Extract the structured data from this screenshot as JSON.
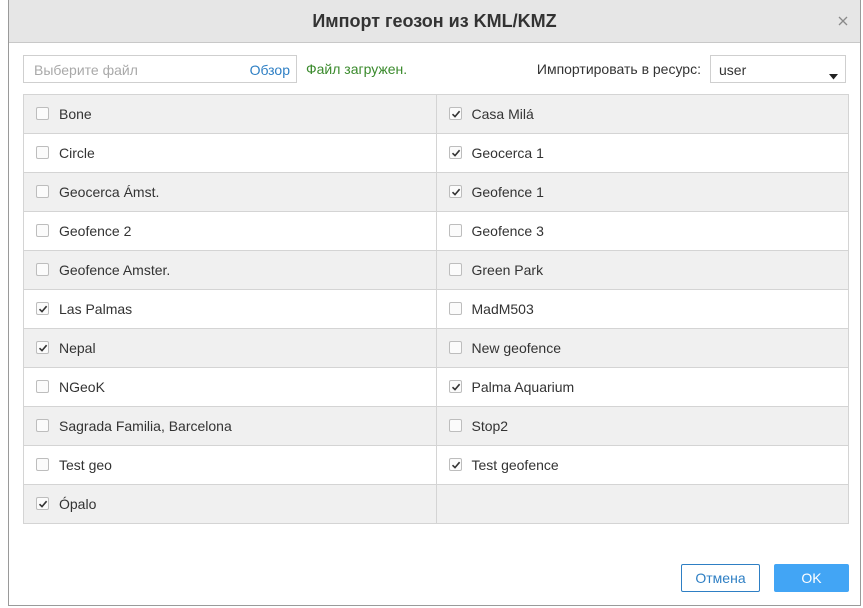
{
  "dialog": {
    "title": "Импорт геозон из KML/KMZ",
    "close_icon": "close-icon"
  },
  "toolbar": {
    "file_placeholder": "Выберите файл",
    "browse_label": "Обзор",
    "status_text": "Файл загружен.",
    "status_color": "#3a8a2c",
    "resource_label": "Импортировать в ресурс:",
    "resource_value": "user"
  },
  "geofences": {
    "left": [
      {
        "label": "Bone",
        "checked": false
      },
      {
        "label": "Circle",
        "checked": false
      },
      {
        "label": "Geocerca Ámst.",
        "checked": false
      },
      {
        "label": "Geofence 2",
        "checked": false
      },
      {
        "label": "Geofence Amster.",
        "checked": false
      },
      {
        "label": "Las Palmas",
        "checked": true
      },
      {
        "label": "Nepal",
        "checked": true
      },
      {
        "label": "NGeoK",
        "checked": false
      },
      {
        "label": "Sagrada Familia, Barcelona",
        "checked": false
      },
      {
        "label": "Test geo",
        "checked": false
      },
      {
        "label": "Ópalo",
        "checked": true
      }
    ],
    "right": [
      {
        "label": "Casa Milá",
        "checked": true
      },
      {
        "label": "Geocerca 1",
        "checked": true
      },
      {
        "label": "Geofence 1",
        "checked": true
      },
      {
        "label": "Geofence 3",
        "checked": false
      },
      {
        "label": "Green Park",
        "checked": false
      },
      {
        "label": "MadM503",
        "checked": false
      },
      {
        "label": "New geofence",
        "checked": false
      },
      {
        "label": "Palma Aquarium",
        "checked": true
      },
      {
        "label": "Stop2",
        "checked": false
      },
      {
        "label": "Test geofence",
        "checked": true
      }
    ]
  },
  "footer": {
    "cancel_label": "Отмена",
    "ok_label": "OK"
  },
  "colors": {
    "accent": "#2e7fc4",
    "ok_button": "#42a5f5",
    "row_alt": "#f0f0f0"
  }
}
